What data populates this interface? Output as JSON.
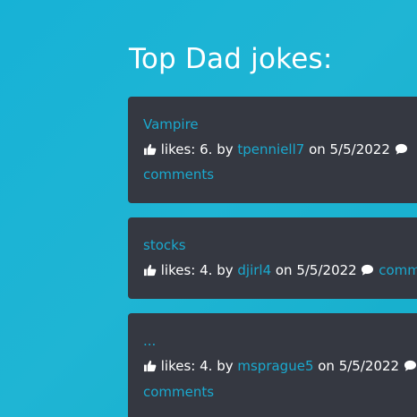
{
  "page": {
    "heading": "Top Dad jokes:"
  },
  "jokes": [
    {
      "title": "Vampire",
      "likes_text": " likes: 6. by ",
      "user": "tpenniell7",
      "date_text": " on 5/5/2022 ",
      "comments_label": "comments"
    },
    {
      "title": "stocks",
      "likes_text": " likes: 4. by ",
      "user": "djirl4",
      "date_text": " on 5/5/2022 ",
      "comments_label": "comm"
    },
    {
      "title": "...",
      "likes_text": " likes: 4. by ",
      "user": "msprague5",
      "date_text": " on 5/5/2022 ",
      "comments_label": "comments"
    }
  ],
  "icons": {
    "like": "thumbs-up-icon",
    "comment": "comment-icon"
  },
  "colors": {
    "background": "#17b2d6",
    "card": "#353841",
    "link": "#1aa9cf",
    "text": "#ffffff"
  }
}
